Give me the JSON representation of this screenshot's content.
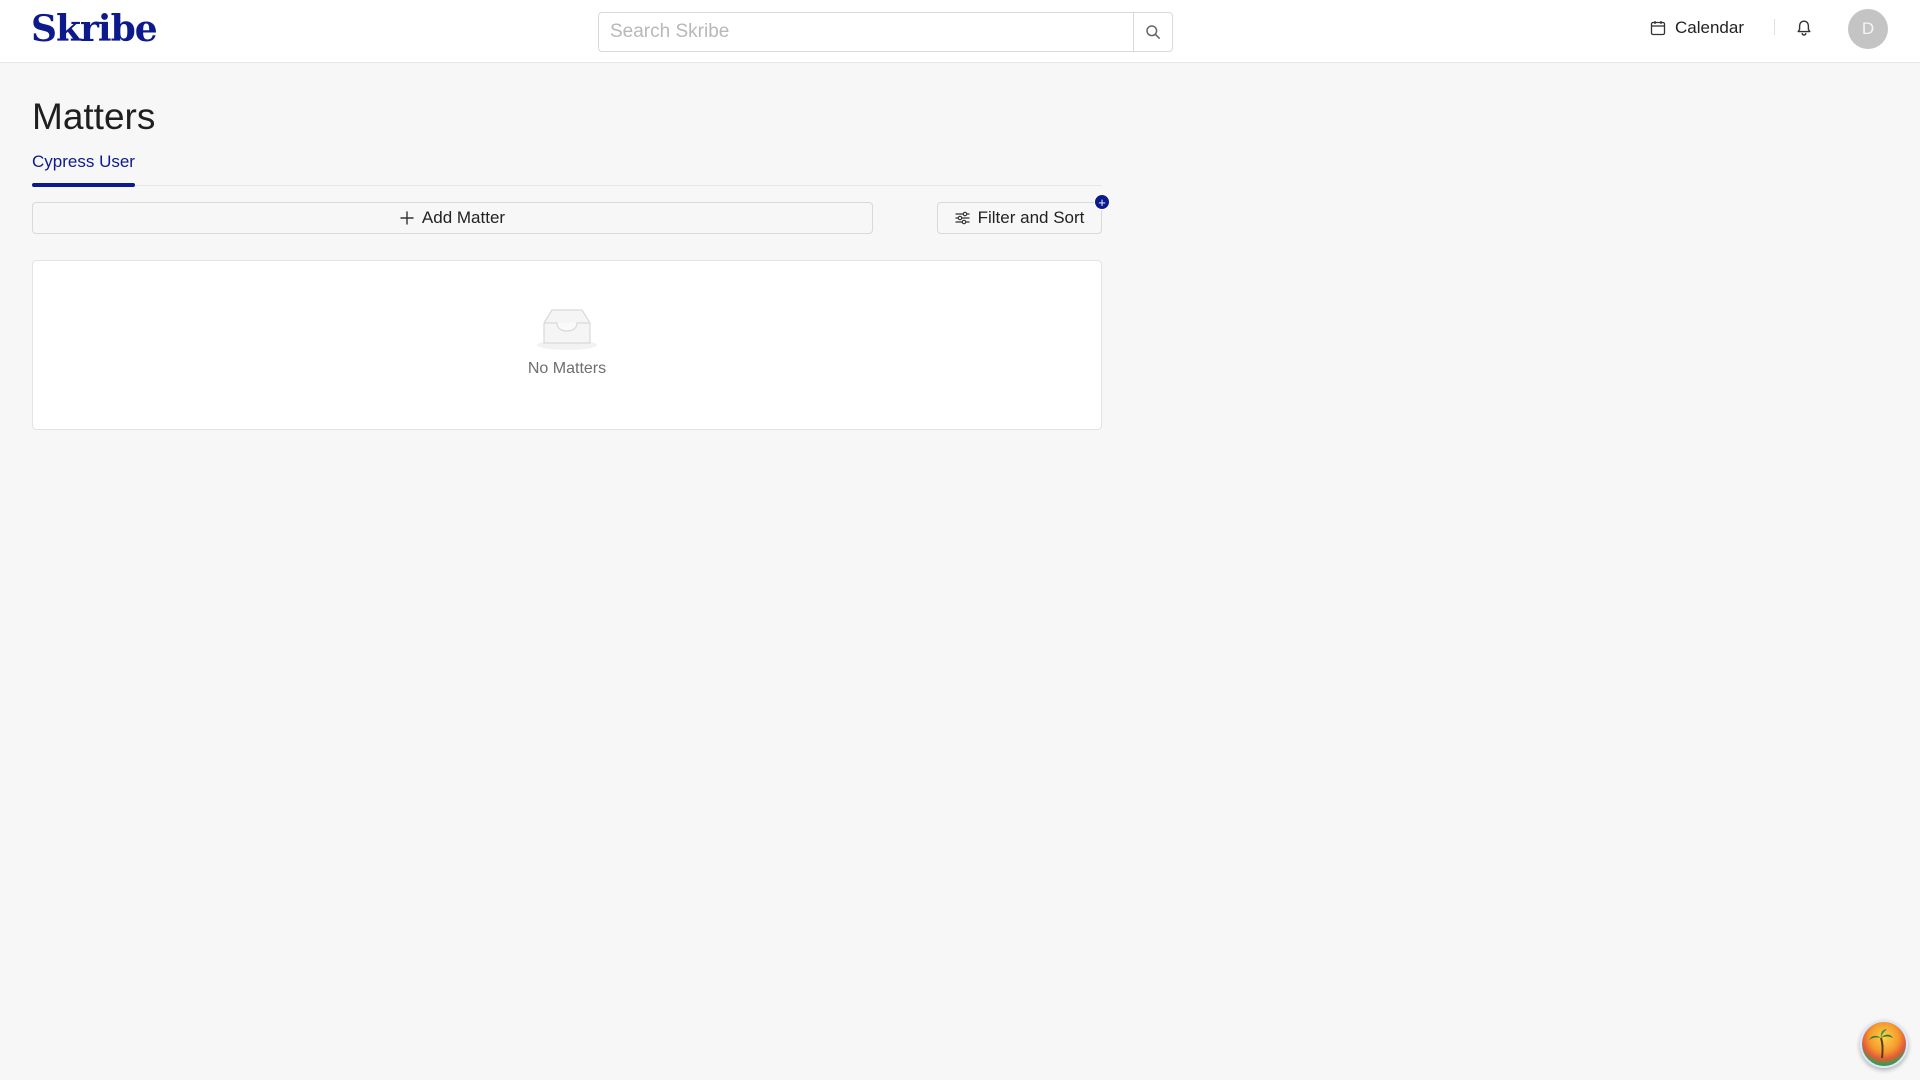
{
  "app": {
    "logo_text": "Skribe"
  },
  "header": {
    "search": {
      "placeholder": "Search Skribe",
      "value": ""
    },
    "calendar_label": "Calendar",
    "avatar_initial": "D"
  },
  "page": {
    "title": "Matters",
    "tabs": [
      {
        "label": "Cypress User",
        "active": true
      }
    ]
  },
  "toolbar": {
    "add_label": "Add Matter",
    "filter_label": "Filter and Sort",
    "filter_badge": "+"
  },
  "empty_state": {
    "text": "No Matters"
  },
  "colors": {
    "brand": "#0d1a8c",
    "background": "#f7f7f7",
    "surface": "#ffffff",
    "border": "#d9d9d9",
    "muted_text": "#6e6e6e"
  },
  "icons": {
    "search": "search-icon",
    "calendar": "calendar-icon",
    "bell": "bell-icon",
    "add": "plus-icon",
    "filter": "sliders-icon",
    "empty": "inbox-icon"
  }
}
